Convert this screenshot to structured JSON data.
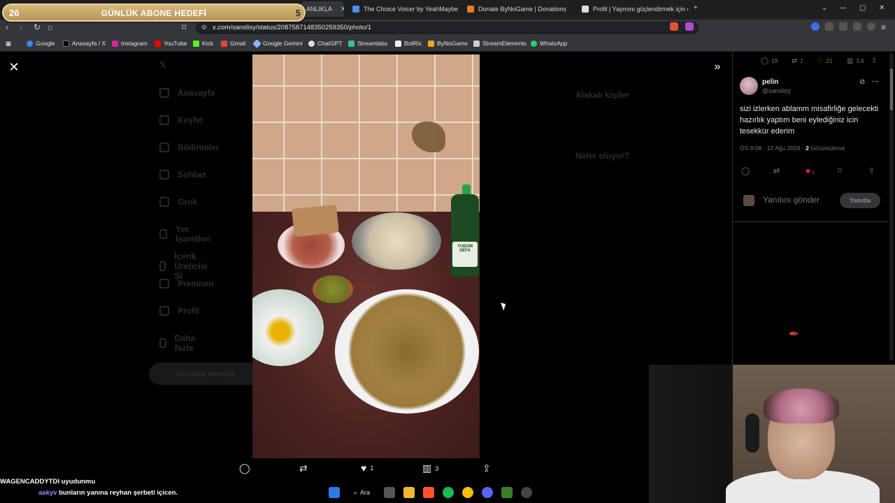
{
  "goal_overlay": {
    "left_number": "26",
    "title": "GÜNLÜK ABONE HEDEFİ",
    "right_number": "5"
  },
  "tabs": [
    {
      "label": "ANLIKLA",
      "active": true
    },
    {
      "label": "The Choice Voicer by YeahMaybe"
    },
    {
      "label": "Donate ByNoGame | Donations"
    },
    {
      "label": "Profil | Yayınını güçlendirmek için en"
    }
  ],
  "address": {
    "url": "x.com/sanslisy/status/2087587148350259350/photo/1"
  },
  "bookmarks": [
    "Google",
    "Anasayfa / X",
    "Instagram",
    "YouTube",
    "Kick",
    "Gmail",
    "Google Gemini",
    "ChatGPT",
    "Streamlabs",
    "BotRix",
    "ByNoGame",
    "StreamElements",
    "WhatsApp"
  ],
  "icons": {
    "close": "✕",
    "expand": "»",
    "reply": "◯",
    "retweet": "⇄",
    "like": "♥",
    "views": "▥",
    "share": "⇪",
    "bookmark": "⌑",
    "more": "⋯",
    "grok": "⊘",
    "feather": "✒"
  },
  "photo": {
    "bottle_label": "YUDUM SEFA",
    "actions": {
      "like_count": "1",
      "views_count": "3"
    }
  },
  "dimmed_sidebar": [
    "Anasayfa",
    "Keşfet",
    "Bildirimler",
    "Sohbet",
    "Grok",
    "Yer İşaretleri",
    "İçerik Üreticisi St",
    "Premium",
    "Profil",
    "Daha fazla"
  ],
  "dimmed_post_button": "Gönderi yayınla",
  "dimmed_right": {
    "relevant": "Alakalı kişiler",
    "trends": "Neler oluyor?"
  },
  "tweet": {
    "top_stats": {
      "replies": "19",
      "retweets": "1",
      "likes": "21",
      "views": "3.8"
    },
    "author_name": "pelin",
    "author_handle": "@sanslisy",
    "text": "sizi izlerken ablamm misafirliğe gelecekti hazırlık yaptım beni eylediğiniz icin tesekkür ederim",
    "time": "ÖS 8:08 · 12 Ağu 2026 ·",
    "views_count": "2",
    "views_label": "Görüntüleme",
    "like_count": "1",
    "reply_placeholder": "Yanıtını gönder",
    "reply_button": "Yanıtla"
  },
  "chat": [
    {
      "user": "WAGENCADDYTDI",
      "message": "uyudunmu"
    },
    {
      "user": "aakyv",
      "message": "bunların yanına reyhan şerbeti içicen."
    }
  ],
  "taskbar": {
    "search_label": "Ara"
  },
  "colors": {
    "like_pink": "#f91880",
    "goal_gold": "#c9a66b",
    "chat_user2": "#b77bff"
  }
}
